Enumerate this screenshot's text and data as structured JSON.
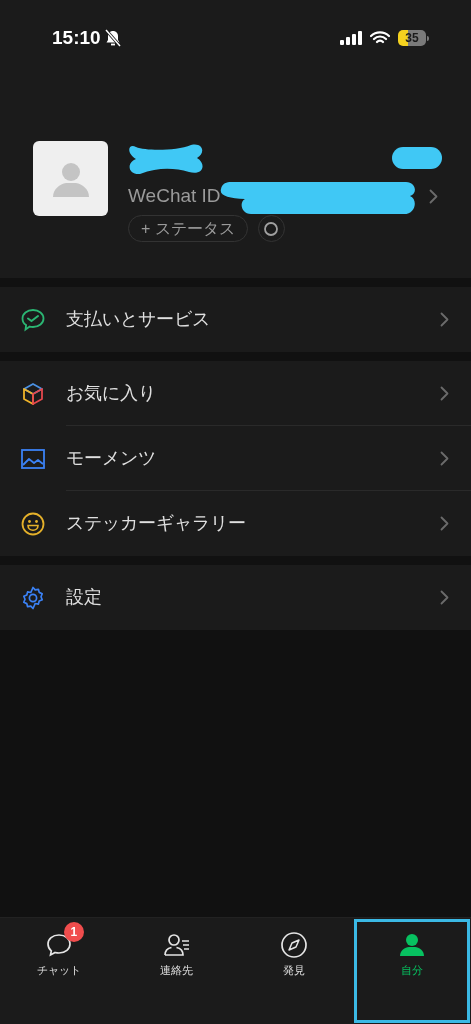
{
  "status_bar": {
    "time": "15:10",
    "battery": "35"
  },
  "profile": {
    "wechat_id_label": "WeChat ID",
    "status_button": "+ ステータス"
  },
  "sections": [
    {
      "items": [
        {
          "kind": "pay",
          "label": "支払いとサービス"
        }
      ]
    },
    {
      "items": [
        {
          "kind": "favorites",
          "label": "お気に入り"
        },
        {
          "kind": "moments",
          "label": "モーメンツ"
        },
        {
          "kind": "stickers",
          "label": "ステッカーギャラリー"
        }
      ]
    },
    {
      "items": [
        {
          "kind": "settings",
          "label": "設定"
        }
      ]
    }
  ],
  "tabs": [
    {
      "kind": "chats",
      "label": "チャット",
      "badge": "1",
      "selected": false
    },
    {
      "kind": "contacts",
      "label": "連絡先",
      "selected": false
    },
    {
      "kind": "discover",
      "label": "発見",
      "selected": false
    },
    {
      "kind": "me",
      "label": "自分",
      "selected": true
    }
  ]
}
